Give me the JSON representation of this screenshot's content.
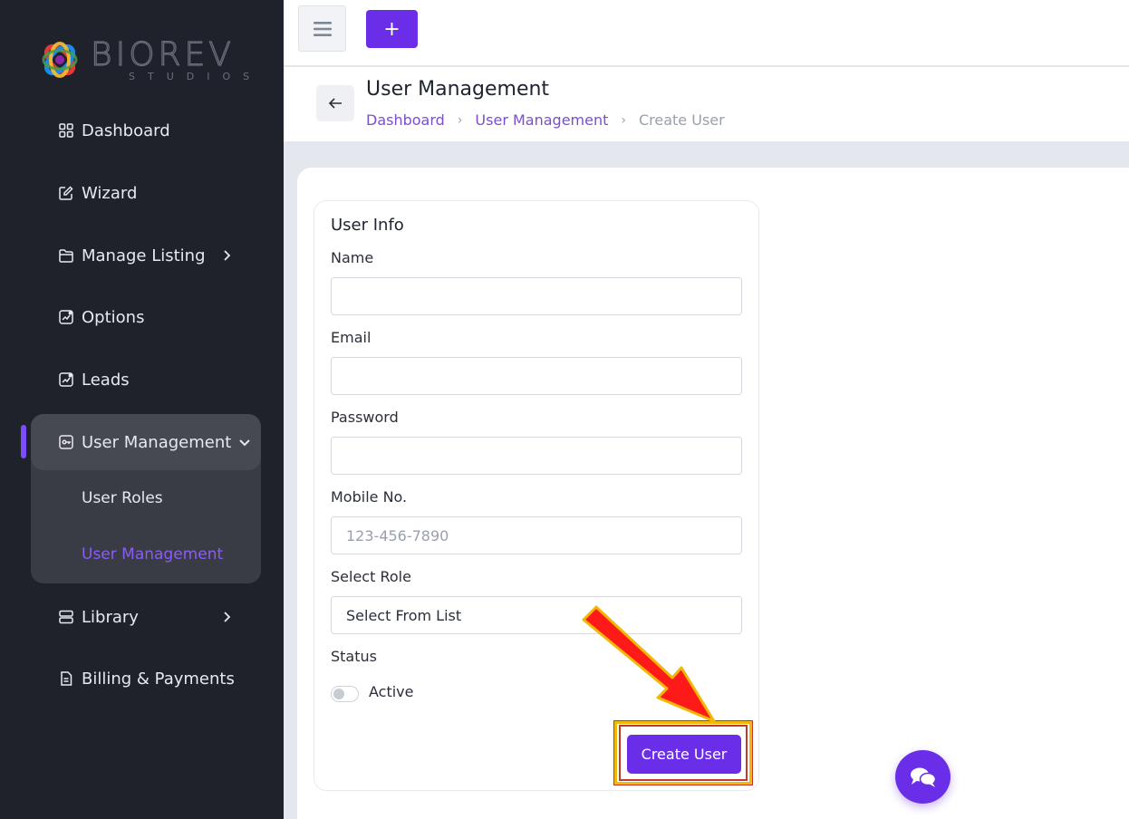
{
  "brand": {
    "name": "BIOREV",
    "tagline": "STUDIOS"
  },
  "sidebar": {
    "items": [
      {
        "label": "Dashboard",
        "icon": "grid-icon"
      },
      {
        "label": "Wizard",
        "icon": "edit-icon"
      },
      {
        "label": "Manage Listing",
        "icon": "folder-icon"
      },
      {
        "label": "Options",
        "icon": "chart-icon"
      },
      {
        "label": "Leads",
        "icon": "chart-icon"
      },
      {
        "label": "User Management",
        "icon": "key-icon"
      },
      {
        "label": "Library",
        "icon": "storage-icon"
      },
      {
        "label": "Billing & Payments",
        "icon": "document-icon"
      }
    ],
    "submenu": [
      {
        "label": "User Roles"
      },
      {
        "label": "User Management"
      }
    ]
  },
  "topbar": {
    "add_label": "+"
  },
  "header": {
    "title": "User Management",
    "breadcrumb": [
      "Dashboard",
      "User Management",
      "Create User"
    ]
  },
  "form": {
    "section_title": "User Info",
    "name_label": "Name",
    "name_value": "",
    "email_label": "Email",
    "email_value": "",
    "password_label": "Password",
    "password_value": "",
    "mobile_label": "Mobile No.",
    "mobile_placeholder": "123-456-7890",
    "role_label": "Select Role",
    "role_value": "Select From List",
    "status_label": "Status",
    "status_toggle_label": "Active",
    "status_active": false,
    "submit_label": "Create User"
  },
  "colors": {
    "accent": "#6a2ee8",
    "sidebar_bg": "#1f222b",
    "annotation_arrow": "#ff1a1a",
    "annotation_outline": "#f2b807"
  }
}
